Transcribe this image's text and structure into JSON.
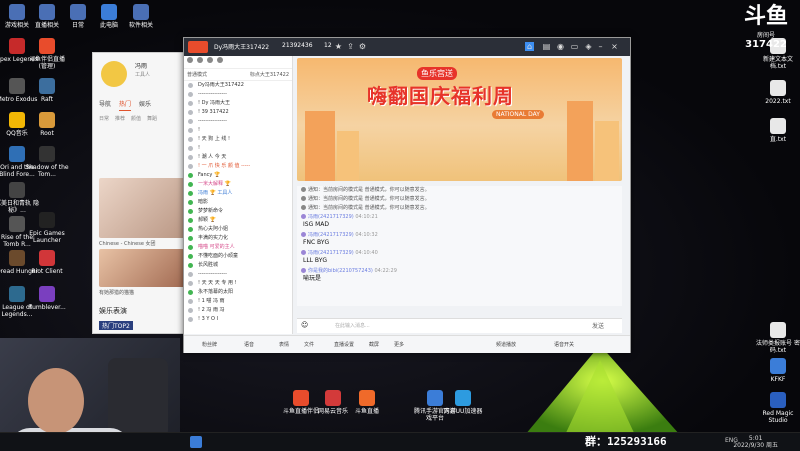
{
  "desktop_left": [
    {
      "label": "游戏相关",
      "color": "#4a6fb5"
    },
    {
      "label": "直播相关",
      "color": "#4a6fb5"
    },
    {
      "label": "日常",
      "color": "#4a6fb5"
    },
    {
      "label": "此电脑",
      "color": "#3b7dd8"
    },
    {
      "label": "软件相关",
      "color": "#4a6fb5"
    }
  ],
  "desktop_col": [
    {
      "label": "Apex Legends",
      "color": "#c62a2a"
    },
    {
      "label": "Metro Exodus",
      "color": "#555"
    },
    {
      "label": "QQ音乐",
      "color": "#f2b705"
    },
    {
      "label": "Ori and the Blind Fore...",
      "color": "#2f6fb5"
    },
    {
      "label": "《美日和青轨 隐秘》...",
      "color": "#444"
    },
    {
      "label": "Rise of the Tomb R...",
      "color": "#555"
    },
    {
      "label": "Dread Hunger",
      "color": "#6b4a2c"
    },
    {
      "label": "League of Legends...",
      "color": "#2d6a8f"
    }
  ],
  "desktop_col2": [
    {
      "label": "斗鱼伴侣直播 (管理)",
      "color": "#e84c2c"
    },
    {
      "label": "Raft",
      "color": "#3c6e9e"
    },
    {
      "label": "Root",
      "color": "#d99a3a"
    },
    {
      "label": "Shadow of the Tom...",
      "color": "#333"
    },
    {
      "label": "Epic Games Launcher",
      "color": "#222"
    },
    {
      "label": "Riot Client",
      "color": "#d13639"
    },
    {
      "label": "Rumblever...",
      "color": "#7a3fbf"
    }
  ],
  "desktop_right": [
    {
      "label": "新建文本文 档.txt",
      "color": "#e8e8e8"
    },
    {
      "label": "2022.txt",
      "color": "#e8e8e8"
    },
    {
      "label": "直.txt",
      "color": "#e8e8e8"
    },
    {
      "label": "法师类报账号 密码.txt",
      "color": "#e8e8e8"
    },
    {
      "label": "KFKF",
      "color": "#3b7dd8"
    },
    {
      "label": "Red Magic Studio",
      "color": "#2a5fbf"
    }
  ],
  "taskbar_apps": [
    {
      "label": "斗鱼直播伴侣",
      "color": "#e84c2c"
    },
    {
      "label": "网易云音乐",
      "color": "#d33a3a"
    },
    {
      "label": "斗鱼直播",
      "color": "#f06a2a"
    },
    {
      "label": "腾讯手游官方游戏平台",
      "color": "#3b7dd8"
    },
    {
      "label": "网易UU加速器",
      "color": "#2d9be0"
    }
  ],
  "dy_logo": {
    "big": "斗鱼",
    "room_label": "房间号",
    "room": "317422"
  },
  "group_number": "群：125293166",
  "clock": {
    "time": "5:01",
    "date": "2022/9/30 周五"
  },
  "tray": {
    "lang": "ENG"
  },
  "side_panel": {
    "name": "冯雨",
    "sub": "工具人",
    "tabs": [
      "导航",
      "热门",
      "娱乐"
    ],
    "active_tab": "热门",
    "subnav": [
      "日常",
      "推荐",
      "颜值",
      "舞蹈"
    ],
    "cap1": "Chinese - Chinese 女团",
    "cap2": "有她那猎的猫猫",
    "section": "娱乐表演",
    "tag": "热门TOP2"
  },
  "window": {
    "title": "Dy冯雨大王317422",
    "id": "21392436",
    "fans": "12",
    "left_mode": "普通模式",
    "left_mode_right": "标点大王317422",
    "left_rows": [
      {
        "t": "Dy冯雨大王317422",
        "c": ""
      },
      {
        "t": "----------------",
        "c": ""
      },
      {
        "t": "!    Dy     冯雨大王",
        "c": ""
      },
      {
        "t": "!    39     317422",
        "c": ""
      },
      {
        "t": "----------------",
        "c": ""
      },
      {
        "t": "!",
        "c": ""
      },
      {
        "t": "!  天  狗  上  线  !",
        "c": ""
      },
      {
        "t": "!",
        "c": ""
      },
      {
        "t": "!  潮    人    今    天",
        "c": ""
      },
      {
        "t": "! 一  爪  快 乐 颜 值 -----",
        "c": "hl"
      },
      {
        "t": "Fancy 🏆",
        "c": "on"
      },
      {
        "t": "一米大解释 🏆",
        "c": "on pink"
      },
      {
        "t": "冯雨 🏆 工具人",
        "c": "on blue"
      },
      {
        "t": "暗影",
        "c": "on"
      },
      {
        "t": "梦梦新命令",
        "c": "on"
      },
      {
        "t": "郝颖 🏆",
        "c": "on"
      },
      {
        "t": "热心夫阿小姐",
        "c": "on"
      },
      {
        "t": "丰满的实力化",
        "c": "on"
      },
      {
        "t": "喵喵 可爱的主人",
        "c": "on pink"
      },
      {
        "t": "不懂吃面的小顽童",
        "c": "on"
      },
      {
        "t": "长风胜城",
        "c": "on"
      },
      {
        "t": "----------------",
        "c": ""
      },
      {
        "t": "! 天 天 天 专 用 !",
        "c": ""
      },
      {
        "t": "永不落幕的太阳",
        "c": "on"
      },
      {
        "t": "!   1    喵   冯   雨",
        "c": ""
      },
      {
        "t": "!   2    冯    雨   冯",
        "c": ""
      },
      {
        "t": "!   3    Y   O   I",
        "c": ""
      }
    ],
    "banner_sub": "鱼乐宫送",
    "banner_title": "嗨翻国庆福利周",
    "banner_nat": "NATIONAL DAY",
    "messages": [
      {
        "type": "sys",
        "text": "通知：当前房间的模式是 普通模式，你可以随意发言。"
      },
      {
        "type": "sys",
        "text": "通知：当前房间的模式是 普通模式，你可以随意发言。"
      },
      {
        "type": "sys",
        "text": "通知：当前房间的模式是 普通模式，你可以随意发言。"
      },
      {
        "type": "user",
        "user": "冯雨(2421717329)",
        "time": "04:10:21",
        "body": "ISG MAD"
      },
      {
        "type": "user",
        "user": "冯雨(2421717329)",
        "time": "04:10:32",
        "body": "FNC BYG"
      },
      {
        "type": "user",
        "user": "冯雨(2421717329)",
        "time": "04:10:40",
        "body": "LLL BYG"
      },
      {
        "type": "user",
        "user": "你是我的bibi(2210757243)",
        "time": "04:22:29",
        "body": "喻玩是"
      }
    ],
    "input_placeholder": "在此输入消息...",
    "send_label": "发送",
    "bottom": [
      "粉丝牌",
      "语音",
      "表情",
      "文件",
      "直播设置",
      "截屏",
      "更多",
      "频道播放",
      "语音开关"
    ]
  }
}
